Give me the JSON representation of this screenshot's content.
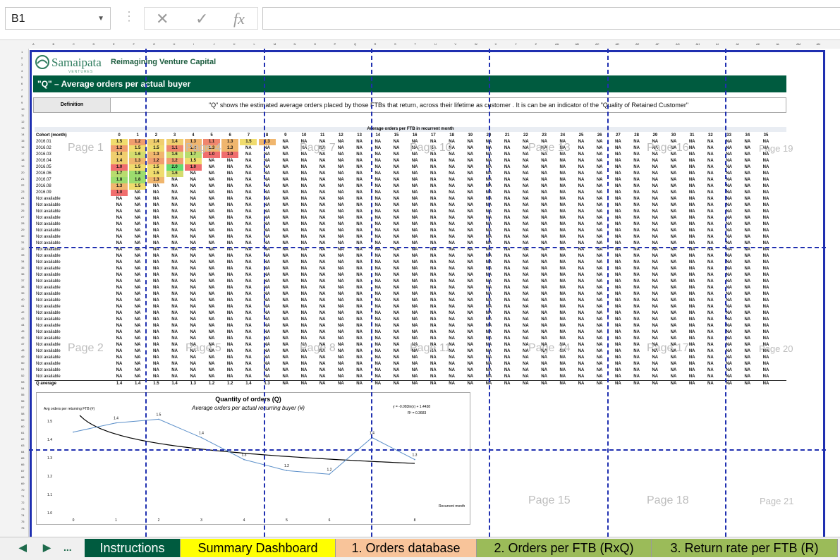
{
  "formula_bar": {
    "name_box": "B1",
    "cancel_glyph": "✕",
    "enter_glyph": "✓",
    "fx_glyph": "fx",
    "formula": ""
  },
  "sheet": {
    "logo_name": "Samaipata",
    "logo_sub": "VENTURES",
    "tagline": "Reimagining Venture Capital",
    "title": "\"Q\" – Average orders per actual buyer",
    "definition_label": "Definition",
    "definition_text": "\"Q\" shows the estimated average orders placed by those FTBs that return, across their lifetime as customer . It is can be an indicator of the \"Quality of Retained Customer\"",
    "table_band": "Average orders per FTB in recurrent month",
    "cohort_header": "Cohort (month)",
    "month_headers": [
      "0",
      "1",
      "2",
      "3",
      "4",
      "5",
      "6",
      "7",
      "8",
      "9",
      "10",
      "11",
      "12",
      "13",
      "14",
      "15",
      "16",
      "17",
      "18",
      "19",
      "20",
      "21",
      "22",
      "23",
      "24",
      "25",
      "26",
      "27",
      "28",
      "29",
      "30",
      "31",
      "32",
      "33",
      "34",
      "35"
    ],
    "cohorts": [
      {
        "label": "2016.01",
        "values": [
          "1.5",
          "1.2",
          "1.4",
          "1.4",
          "1.3",
          "1.1",
          "1.3",
          "1.5",
          "1.3"
        ]
      },
      {
        "label": "2016.02",
        "values": [
          "1.2",
          "1.5",
          "1.5",
          "1.1",
          "1.3",
          "1.3",
          "1.3"
        ]
      },
      {
        "label": "2016.03",
        "values": [
          "1.4",
          "1.6",
          "1.3",
          "1.6",
          "1.7",
          "1.0",
          "1.0"
        ]
      },
      {
        "label": "2016.04",
        "values": [
          "1.4",
          "1.3",
          "1.2",
          "1.2",
          "1.5"
        ]
      },
      {
        "label": "2016.05",
        "values": [
          "1.0",
          "1.5",
          "1.5",
          "2.0",
          "1.0"
        ]
      },
      {
        "label": "2016.06",
        "values": [
          "1.7",
          "1.8",
          "1.5",
          "1.6"
        ]
      },
      {
        "label": "2016.07",
        "values": [
          "1.8",
          "1.8",
          "1.3"
        ]
      },
      {
        "label": "2016.08",
        "values": [
          "1.3",
          "1.5"
        ]
      },
      {
        "label": "2016.09",
        "values": [
          "1.0"
        ]
      }
    ],
    "na_text": "NA",
    "not_available_label": "Not available",
    "not_available_rows": 29,
    "average_label": "Q average",
    "average_values": [
      "1.4",
      "1.4",
      "1.5",
      "1.4",
      "1.3",
      "1.2",
      "1.2",
      "1.4",
      "1.3"
    ],
    "page_labels": [
      "Page 1",
      "Page 4",
      "Page 7",
      "Page 10",
      "Page 13",
      "Page 16",
      "Page 19",
      "Page 2",
      "Page 5",
      "Page 8",
      "Page 11",
      "Page 14",
      "Page 17",
      "Page 20",
      "Page 15",
      "Page 18",
      "Page 21"
    ]
  },
  "chart_data": {
    "type": "line",
    "title": "Quantity of orders (Q)",
    "subtitle": "Average orders per actual recurring buyer (#)",
    "ylabel": "Avg orders per returning FTB (#)",
    "xlabel": "Recurrent month",
    "x": [
      0,
      1,
      2,
      3,
      4,
      5,
      6,
      7,
      8
    ],
    "series": [
      {
        "values": [
          1.44,
          1.49,
          1.51,
          1.41,
          1.29,
          1.23,
          1.21,
          1.41,
          1.29
        ],
        "labels": [
          "",
          "1.4",
          "1.5",
          "1.4",
          "1.3",
          "1.2",
          "1.2",
          "1.4",
          "1.3"
        ]
      }
    ],
    "trendline": {
      "equation": "y = -0.083ln(x) + 1.4438",
      "r2": "R² = 0.3683",
      "a": -0.083,
      "b": 1.4438
    },
    "ylim": [
      1.0,
      1.5
    ],
    "yticks": [
      "1.0",
      "1.1",
      "1.2",
      "1.3",
      "1.4",
      "1.5"
    ],
    "colors": {
      "series": "#5b8fc9",
      "trend": "#000000"
    }
  },
  "tabs": {
    "nav_prev": "◀",
    "nav_next": "▶",
    "nav_more": "...",
    "items": [
      {
        "label": "Instructions",
        "bg": "#005b3f",
        "fg": "#ffffff"
      },
      {
        "label": "Summary Dashboard",
        "bg": "#ffff00",
        "fg": "#000000"
      },
      {
        "label": "1. Orders database",
        "bg": "#f8c49a",
        "fg": "#000000"
      },
      {
        "label": "2. Orders per FTB (RxQ)",
        "bg": "#9bbb59",
        "fg": "#000000"
      },
      {
        "label": "3. Return rate per FTB (R)",
        "bg": "#9bbb59",
        "fg": "#000000"
      }
    ]
  }
}
